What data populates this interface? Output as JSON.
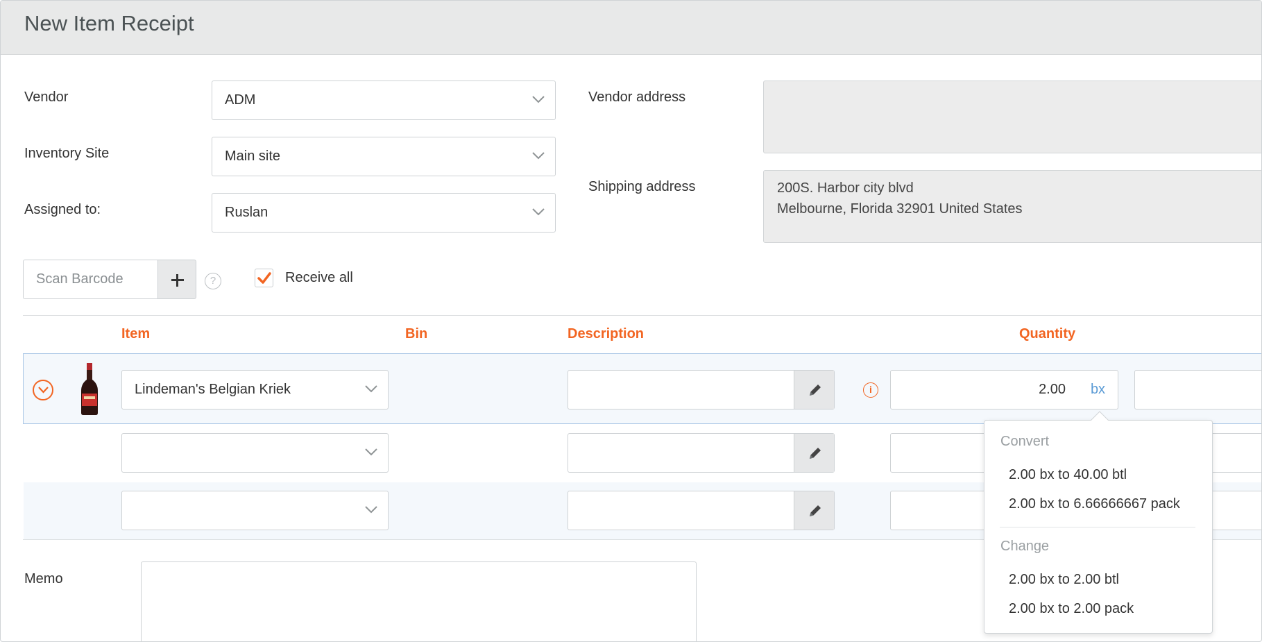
{
  "header": {
    "title": "New Item Receipt"
  },
  "form": {
    "vendor_label": "Vendor",
    "vendor_value": "ADM",
    "site_label": "Inventory Site",
    "site_value": "Main site",
    "assigned_label": "Assigned to:",
    "assigned_value": "Ruslan",
    "vendor_address_label": "Vendor address",
    "shipping_address_label": "Shipping address",
    "shipping_address_line1": "200S. Harbor city blvd",
    "shipping_address_line2": "Melbourne, Florida 32901 United States"
  },
  "toolbar": {
    "scan_placeholder": "Scan Barcode",
    "help_glyph": "?",
    "receive_all_label": "Receive all",
    "receive_all_checked": true
  },
  "table": {
    "columns": {
      "item": "Item",
      "bin": "Bin",
      "description": "Description",
      "quantity": "Quantity"
    },
    "rows": [
      {
        "item": "Lindeman's Belgian Kriek",
        "description": "",
        "quantity": "2.00",
        "unit": "bx",
        "info_glyph": "i"
      },
      {
        "item": "",
        "description": "",
        "quantity": ""
      },
      {
        "item": "",
        "description": "",
        "quantity": ""
      }
    ]
  },
  "unit_popover": {
    "convert_title": "Convert",
    "convert_options": [
      "2.00 bx to 40.00 btl",
      "2.00 bx to 6.66666667 pack"
    ],
    "change_title": "Change",
    "change_options": [
      "2.00 bx to 2.00 btl",
      "2.00 bx to 2.00 pack"
    ]
  },
  "memo": {
    "label": "Memo",
    "value": ""
  },
  "colors": {
    "accent": "#f26522",
    "link": "#5b9bd5",
    "header_bg": "#e8e9e9",
    "row_highlight": "#f4f8fc"
  },
  "icons": [
    "chevron-down-icon",
    "plus-icon",
    "help-icon",
    "check-icon",
    "expand-row-icon",
    "pencil-icon",
    "info-icon",
    "product-image"
  ]
}
